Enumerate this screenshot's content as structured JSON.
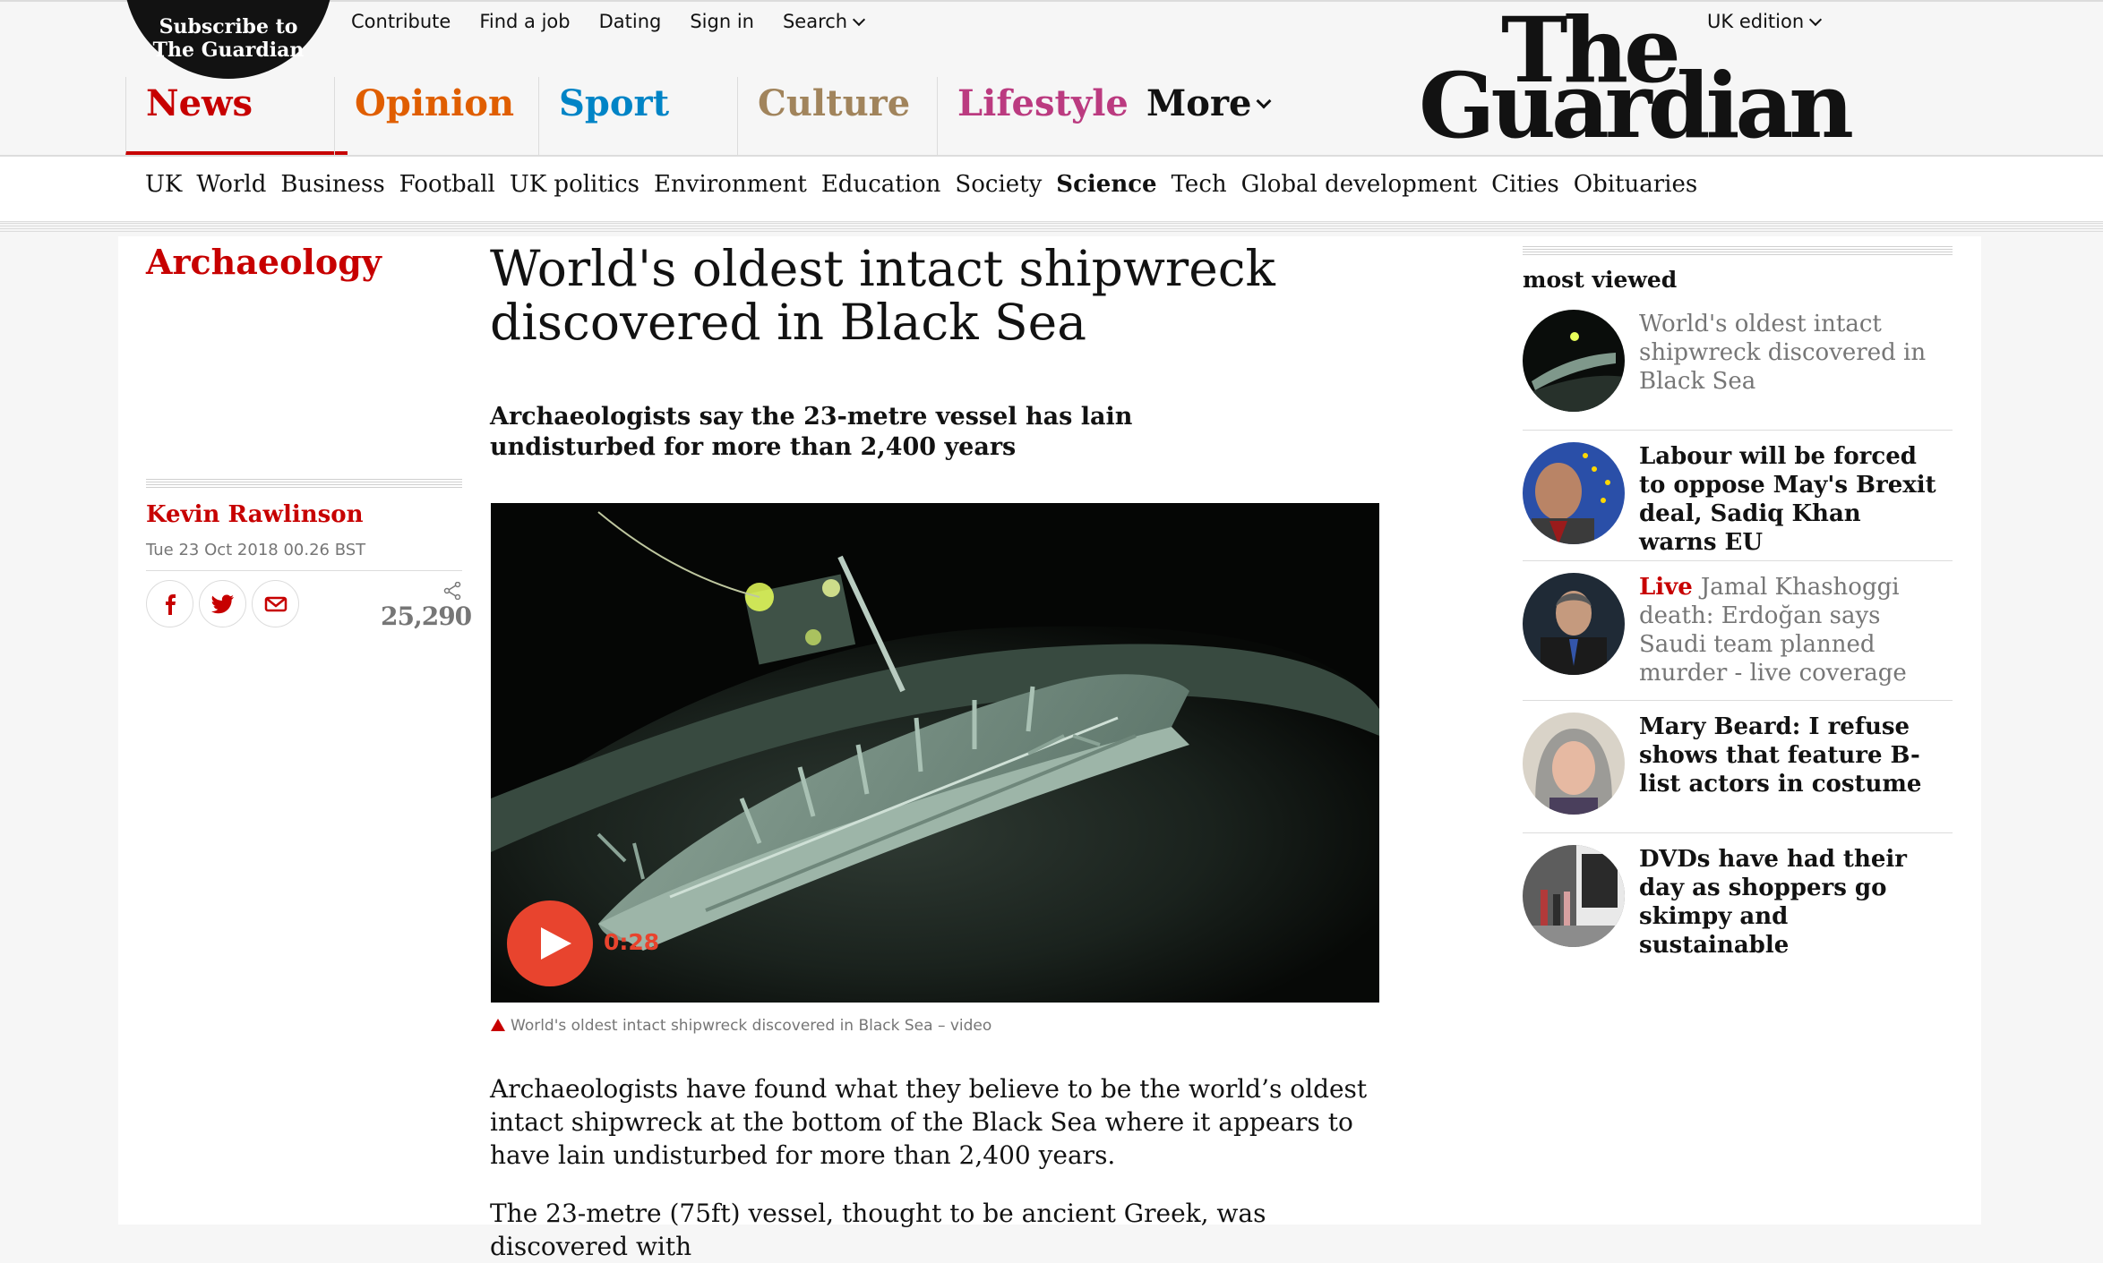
{
  "header": {
    "subscribe_label": "Subscribe to The Guardian",
    "top_links": [
      "Contribute",
      "Find a job",
      "Dating",
      "Sign in",
      "Search"
    ],
    "edition": "UK edition",
    "logo_line1": "The",
    "logo_line2": "Guardian",
    "pillars": [
      {
        "label": "News",
        "color": "#c70000",
        "active": true
      },
      {
        "label": "Opinion",
        "color": "#e05e00"
      },
      {
        "label": "Sport",
        "color": "#0084c6"
      },
      {
        "label": "Culture",
        "color": "#a1845c"
      },
      {
        "label": "Lifestyle",
        "color": "#bb3b80"
      },
      {
        "label": "More",
        "color": "#121212"
      }
    ]
  },
  "subnav": {
    "items": [
      "UK",
      "World",
      "Business",
      "Football",
      "UK politics",
      "Environment",
      "Education",
      "Society",
      "Science",
      "Tech",
      "Global development",
      "Cities",
      "Obituaries"
    ],
    "active": "Science"
  },
  "article": {
    "section": "Archaeology",
    "headline": "World's oldest intact shipwreck discovered in Black Sea",
    "standfirst": "Archaeologists say the 23-metre vessel has lain undisturbed for more than 2,400 years",
    "byline": "Kevin Rawlinson",
    "date": "Tue 23 Oct 2018 00.26 BST",
    "share_count": "25,290",
    "video": {
      "duration": "0:28",
      "caption": "World's oldest intact shipwreck discovered in Black Sea – video"
    },
    "paragraphs": [
      "Archaeologists have found what they believe to be the world’s oldest intact shipwreck at the bottom of the Black Sea where it appears to have lain undisturbed for more than 2,400 years.",
      "The 23-metre (75ft) vessel, thought to be ancient Greek, was discovered with"
    ]
  },
  "most_viewed": {
    "title": "most viewed",
    "items": [
      {
        "text": "World's oldest intact shipwreck discovered in Black Sea",
        "read": true
      },
      {
        "text": "Labour will be forced to oppose May's Brexit deal, Sadiq Khan warns EU"
      },
      {
        "live": "Live",
        "text": "Jamal Khashoggi death: Erdoğan says Saudi team planned murder - live coverage"
      },
      {
        "text": "Mary Beard: I refuse shows that feature B-list actors in costume"
      },
      {
        "text": "DVDs have had their day as shoppers go skimpy and sustainable"
      }
    ]
  },
  "colors": {
    "news_red": "#c70000",
    "play_button": "#e8442e",
    "muted_text": "#767676"
  }
}
